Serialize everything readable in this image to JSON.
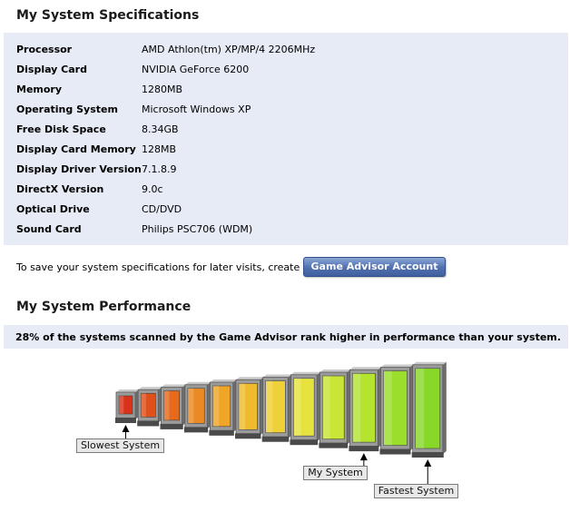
{
  "specifications": {
    "title": "My System Specifications",
    "rows": [
      {
        "label": "Processor",
        "value": "AMD Athlon(tm) XP/MP/4 2206MHz"
      },
      {
        "label": "Display Card",
        "value": "NVIDIA GeForce 6200"
      },
      {
        "label": "Memory",
        "value": "1280MB"
      },
      {
        "label": "Operating System",
        "value": "Microsoft Windows XP"
      },
      {
        "label": "Free Disk Space",
        "value": "8.34GB"
      },
      {
        "label": "Display Card Memory",
        "value": "128MB"
      },
      {
        "label": "Display Driver Version",
        "value": "7.1.8.9"
      },
      {
        "label": "DirectX Version",
        "value": "9.0c"
      },
      {
        "label": "Optical Drive",
        "value": "CD/DVD"
      },
      {
        "label": "Sound Card",
        "value": "Philips PSC706 (WDM)"
      }
    ]
  },
  "save": {
    "text": "To save your system specifications for later visits, create a free",
    "button_label": "Game Advisor Account"
  },
  "performance": {
    "title": "My System Performance",
    "rank_text": "28% of the systems scanned by the Game Advisor rank higher in performance than your system.",
    "percent_higher": 28,
    "markers": {
      "slowest": "Slowest System",
      "mine": "My System",
      "fastest": "Fastest System"
    },
    "tower_count": 12,
    "my_system_tower_index": 9,
    "tower_colors": [
      "#d8321a",
      "#e0501a",
      "#e56a1c",
      "#eb8a22",
      "#f0a528",
      "#efbb2e",
      "#eed038",
      "#e6e23e",
      "#c9e536",
      "#b4e330",
      "#9cde2c",
      "#88d82a"
    ]
  }
}
